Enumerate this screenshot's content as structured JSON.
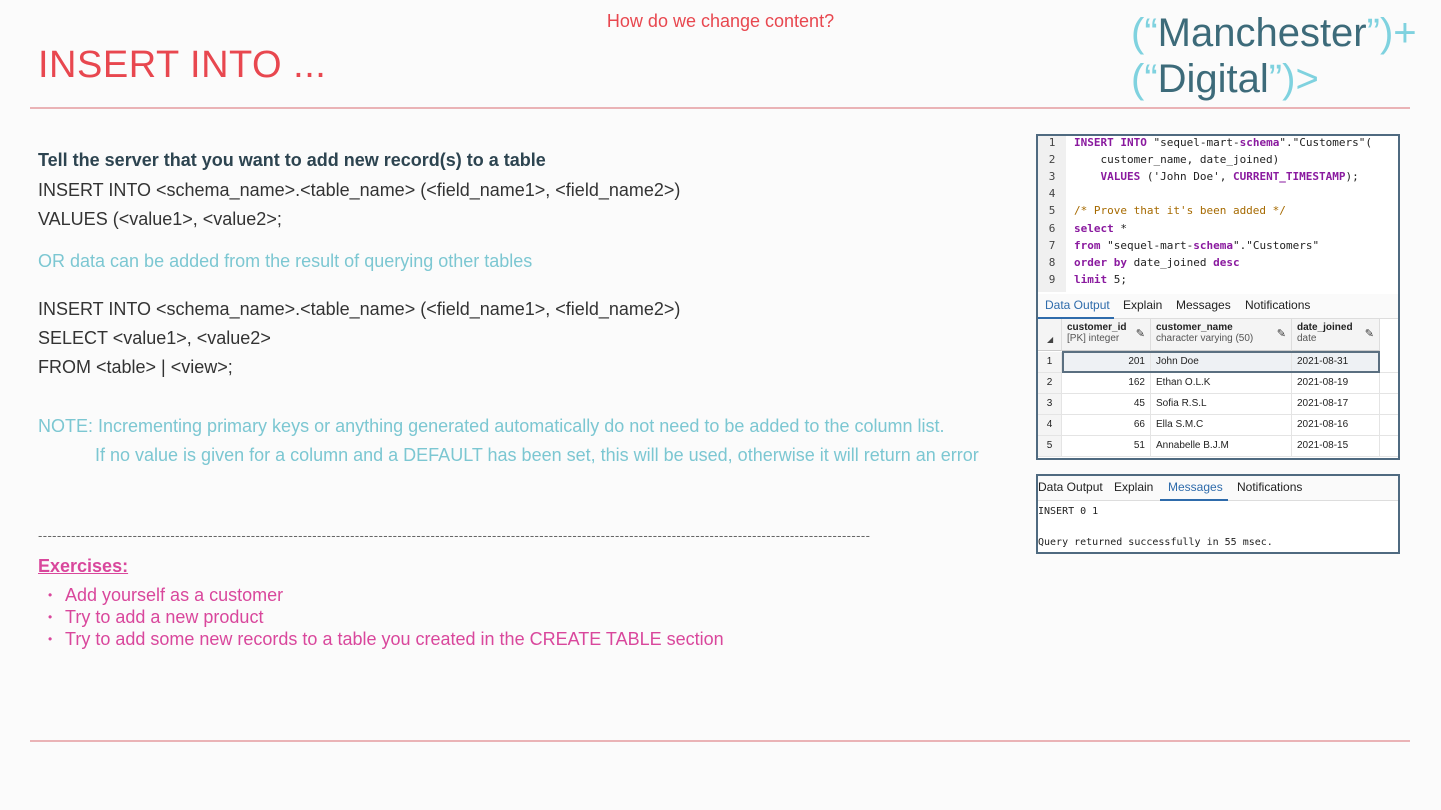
{
  "header": {
    "subtitle": "How do we change content?",
    "title": "INSERT INTO ...",
    "logo_line1_open": "(“",
    "logo_line1_word": "Manchester",
    "logo_line1_close": "”)+",
    "logo_line2_open": "(“",
    "logo_line2_word": "Digital",
    "logo_line2_close": "”)>"
  },
  "body": {
    "lead": "Tell the server that you want to add new record(s) to a table",
    "syntax1_line1": "INSERT INTO <schema_name>.<table_name> (<field_name1>, <field_name2>)",
    "syntax1_line2": "VALUES (<value1>, <value2>;",
    "or_note": "OR data can be added from the result of querying other tables",
    "syntax2_line1": "INSERT INTO <schema_name>.<table_name> (<field_name1>, <field_name2>)",
    "syntax2_line2": "SELECT <value1>, <value2>",
    "syntax2_line3": "FROM <table> | <view>;",
    "note_line1": "NOTE: Incrementing primary keys or anything generated automatically do not need to be added to the column list.",
    "note_line2": "If no value is given for a column and a DEFAULT has been set, this will be used, otherwise it will return an error",
    "divider": "--------------------------------------------------------------------------------------------------------------------------------------------------------------------------------"
  },
  "exercises": {
    "title": "Exercises:",
    "bullet_glyph": "•",
    "items": [
      "Add yourself as a customer",
      "Try to add a new product",
      "Try to add some new records to a table you created in the CREATE TABLE section"
    ]
  },
  "sql_editor": {
    "line_numbers": [
      "1",
      "2",
      "3",
      "4",
      "5",
      "6",
      "7",
      "8",
      "9"
    ],
    "l1_kw": "INSERT INTO",
    "l1_a": " \"sequel-mart-",
    "l1_kw2": "schema",
    "l1_b": "\".\"Customers\"(",
    "l2": "    customer_name, date_joined)",
    "l3_kw": "    VALUES",
    "l3_a": " ('John Doe', ",
    "l3_kw2": "CURRENT_TIMESTAMP",
    "l3_b": ");",
    "l5": "/* Prove that it's been added */",
    "l6_kw": "select",
    "l6_a": " *",
    "l7_kw": "from",
    "l7_a": " \"sequel-mart-",
    "l7_kw2": "schema",
    "l7_b": "\".\"Customers\"",
    "l8_kw": "order by",
    "l8_a": " date_joined ",
    "l8_kw2": "desc",
    "l9_kw": "limit",
    "l9_a": " 5;"
  },
  "result_tabs": [
    "Data Output",
    "Explain",
    "Messages",
    "Notifications"
  ],
  "grid": {
    "columns": [
      {
        "name": "customer_id",
        "type": "[PK] integer"
      },
      {
        "name": "customer_name",
        "type": "character varying (50)"
      },
      {
        "name": "date_joined",
        "type": "date"
      }
    ],
    "rows": [
      {
        "n": "1",
        "id": "201",
        "name": "John Doe",
        "date": "2021-08-31"
      },
      {
        "n": "2",
        "id": "162",
        "name": "Ethan O.L.K",
        "date": "2021-08-19"
      },
      {
        "n": "3",
        "id": "45",
        "name": "Sofia R.S.L",
        "date": "2021-08-17"
      },
      {
        "n": "4",
        "id": "66",
        "name": "Ella S.M.C",
        "date": "2021-08-16"
      },
      {
        "n": "5",
        "id": "51",
        "name": "Annabelle B.J.M",
        "date": "2021-08-15"
      }
    ]
  },
  "messages": {
    "line1": "INSERT 0 1",
    "line2": "Query returned successfully in 55 msec."
  },
  "colors": {
    "accent_red": "#e8474f",
    "accent_pink": "#d9479c",
    "accent_teal": "#7cc7d2",
    "logo_dark": "#3d6b7a"
  }
}
